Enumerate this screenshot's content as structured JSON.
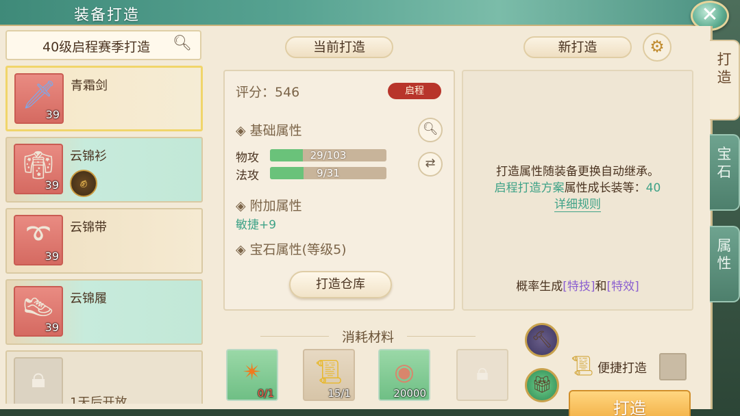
{
  "header": {
    "title": "装备打造",
    "close_icon": "close-icon"
  },
  "side_tabs": [
    {
      "label": "打造",
      "active": true
    },
    {
      "label": "宝石",
      "active": false
    },
    {
      "label": "属性",
      "active": false
    }
  ],
  "search": {
    "text": "40级启程赛季打造",
    "icon": "search-icon"
  },
  "equipment_list": [
    {
      "name": "青霜剑",
      "level": "39",
      "icon": "sword-icon",
      "selected": true
    },
    {
      "name": "云锦衫",
      "level": "39",
      "icon": "robe-icon",
      "badge_icon": "fist-upgrade-icon"
    },
    {
      "name": "云锦带",
      "level": "39",
      "icon": "belt-icon"
    },
    {
      "name": "云锦履",
      "level": "39",
      "icon": "shoes-icon"
    },
    {
      "name": "1天后开放",
      "icon": "lock-icon",
      "locked": true
    }
  ],
  "current": {
    "tab_label": "当前打造",
    "score_label": "评分：546",
    "tag": "启程",
    "basic_title": "基础属性",
    "stats": [
      {
        "name": "物攻",
        "value": 29,
        "max": 103,
        "text": "29/103"
      },
      {
        "name": "法攻",
        "value": 9,
        "max": 31,
        "text": "9/31"
      }
    ],
    "extra_title": "附加属性",
    "extra_value": "敏捷+9",
    "gem_title": "宝石属性(等级5)",
    "forge_storage_label": "打造仓库"
  },
  "new": {
    "tab_label": "新打造",
    "line1": "打造属性随装备更换自动继承。",
    "line2_teal": "启程打造方案",
    "line2_rest": "属性成长装等：",
    "line2_value": "40",
    "rules_link": "详细规则",
    "prob_prefix": "概率生成",
    "prob_skill": "[特技]",
    "prob_and": "和",
    "prob_effect": "[特效]"
  },
  "materials": {
    "title": "消耗材料",
    "items": [
      {
        "icon": "orange-gem-icon",
        "count": "0/1",
        "insufficient": true
      },
      {
        "icon": "golden-scroll-icon",
        "count": "15/1"
      },
      {
        "icon": "copper-coin-icon",
        "count": "20000"
      },
      {
        "icon": "lock-icon",
        "count": ""
      }
    ]
  },
  "actions": {
    "quick_label": "便捷打造",
    "forge_label": "打造",
    "hammer_icon": "forge-hammer-icon",
    "gift_icon": "gift-box-icon"
  }
}
